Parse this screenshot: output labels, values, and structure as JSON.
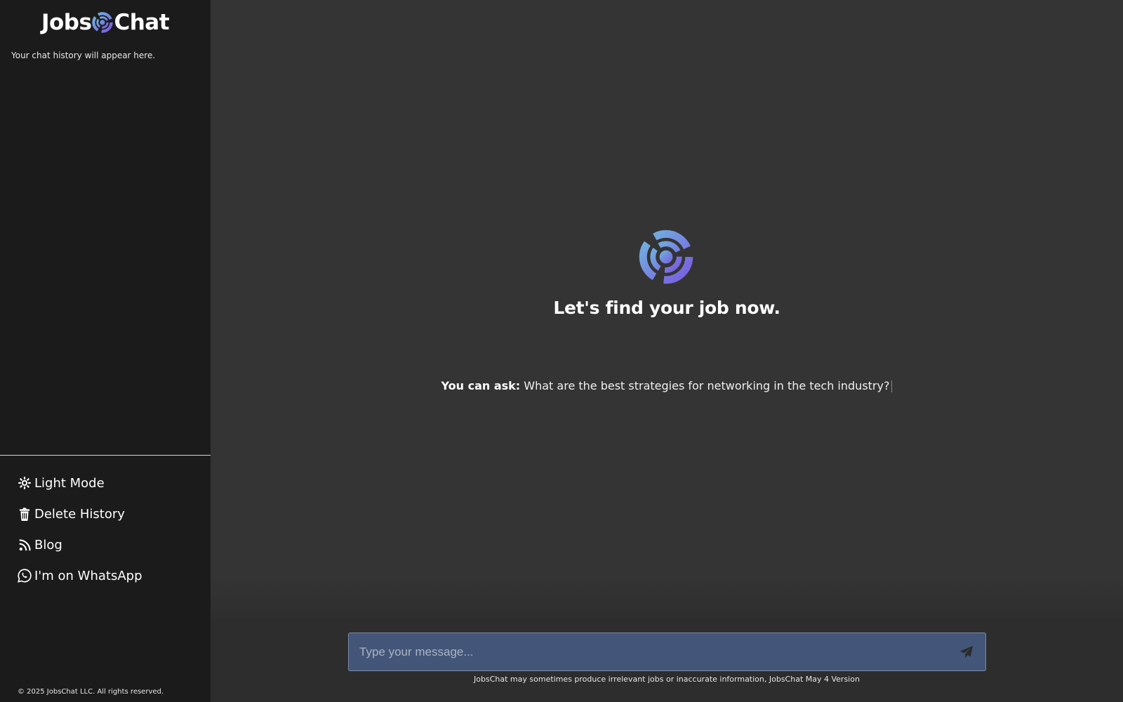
{
  "brand": {
    "name_left": "Jobs",
    "name_right": "Chat",
    "logo_icon": "jobschat-target-icon",
    "gradient_start": "#6fb7e0",
    "gradient_end": "#7a5ae0"
  },
  "sidebar": {
    "history_empty": "Your chat history will appear here.",
    "menu": [
      {
        "label": "Light Mode",
        "icon": "sun-icon"
      },
      {
        "label": "Delete History",
        "icon": "trash-icon"
      },
      {
        "label": "Blog",
        "icon": "rss-icon"
      },
      {
        "label": "I'm on WhatsApp",
        "icon": "whatsapp-icon"
      }
    ],
    "copyright": "© 2025 JobsChat LLC. All rights reserved."
  },
  "main": {
    "title": "Let's find your job now.",
    "suggest_prefix": "You can ask:",
    "suggest_text": "What are the best strategies for networking in the tech industry?",
    "input_placeholder": "Type your message...",
    "send_icon": "send-icon",
    "disclaimer": "JobsChat may sometimes produce irrelevant jobs or inaccurate information, JobsChat May 4 Version"
  },
  "colors": {
    "sidebar_bg": "#1b1b1b",
    "main_bg": "#343434",
    "input_bg": "#435679"
  }
}
